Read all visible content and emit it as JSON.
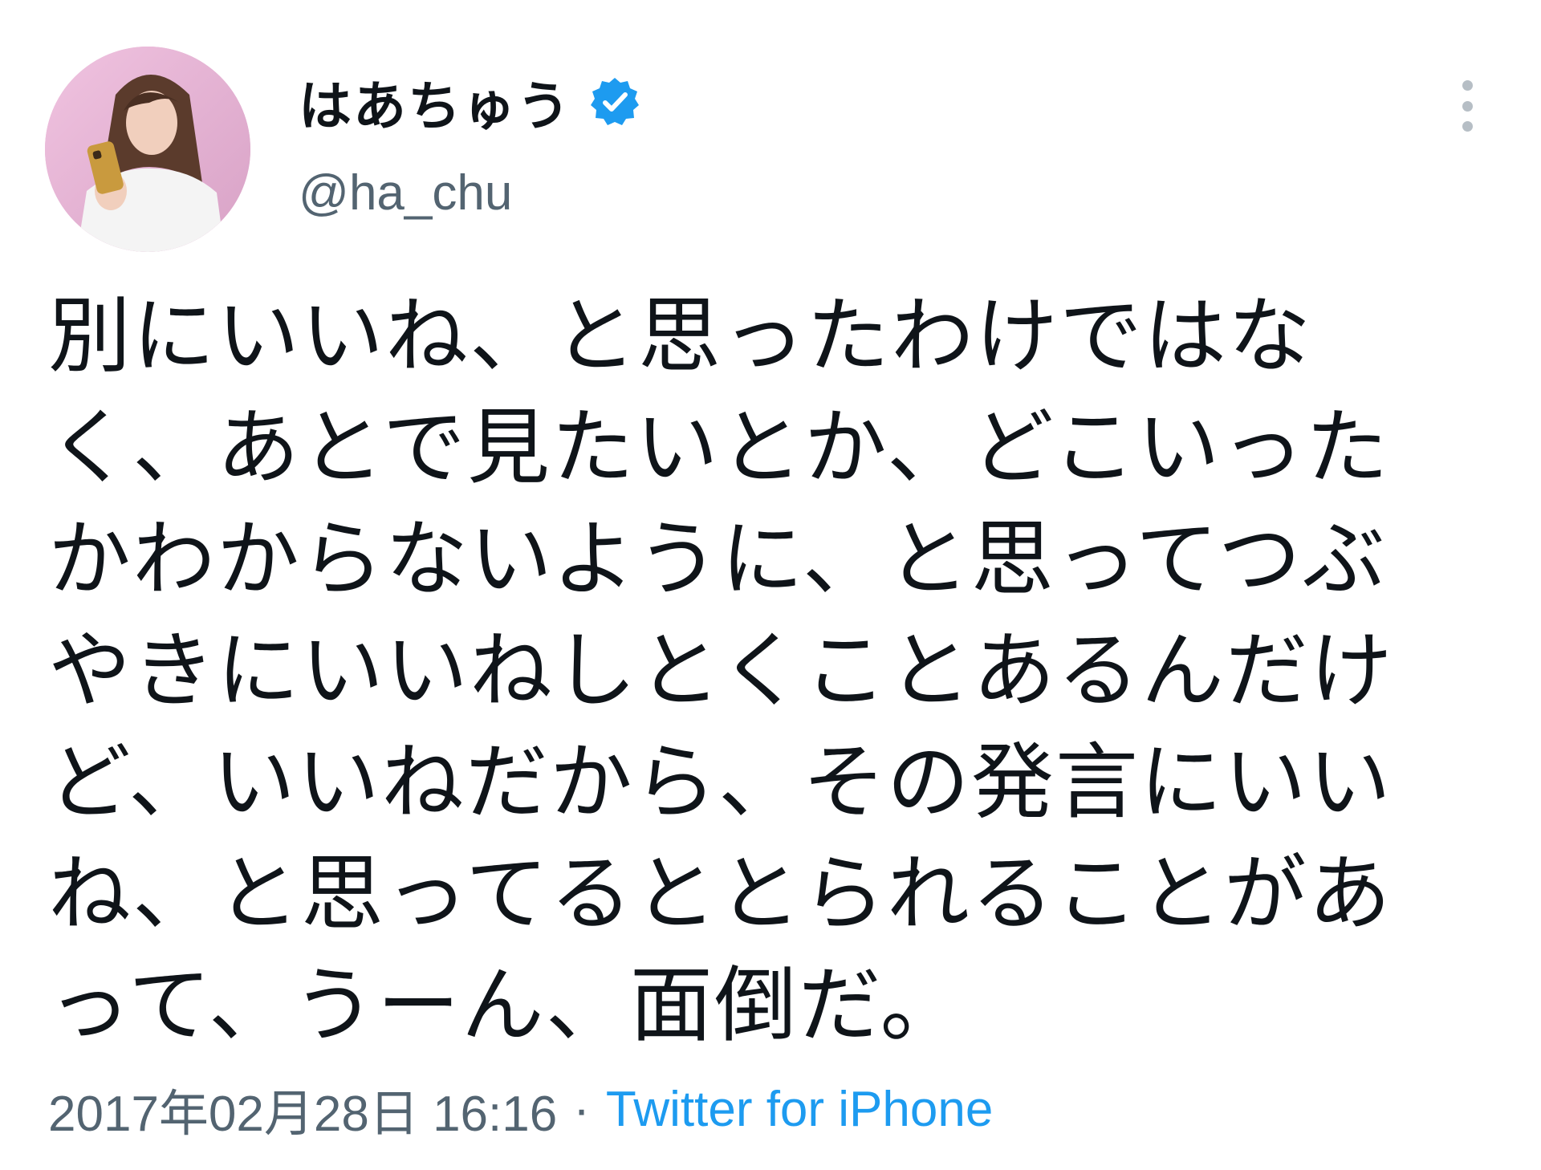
{
  "user": {
    "display_name": "はあちゅう",
    "handle": "@ha_chu",
    "verified_icon": "verified-badge-icon",
    "avatar_icon": "profile-photo"
  },
  "tweet": {
    "lines": [
      "別にいいね、と思ったわけではな",
      "く、あとで見たいとか、どこいった",
      "かわからないように、と思ってつぶ",
      "やきにいいねしとくことあるんだけ",
      "ど、いいねだから、その発言にいい",
      "ね、と思ってるととられることがあ",
      "って、うーん、面倒だ。"
    ],
    "timestamp": "2017年02月28日 16:16",
    "separator": "·",
    "source": "Twitter for iPhone"
  },
  "menu": {
    "icon": "more-vertical-icon"
  },
  "colors": {
    "text": "#0f1419",
    "secondary": "#536471",
    "accent": "#1d9bf0",
    "menu_dots": "#b6bec5"
  }
}
